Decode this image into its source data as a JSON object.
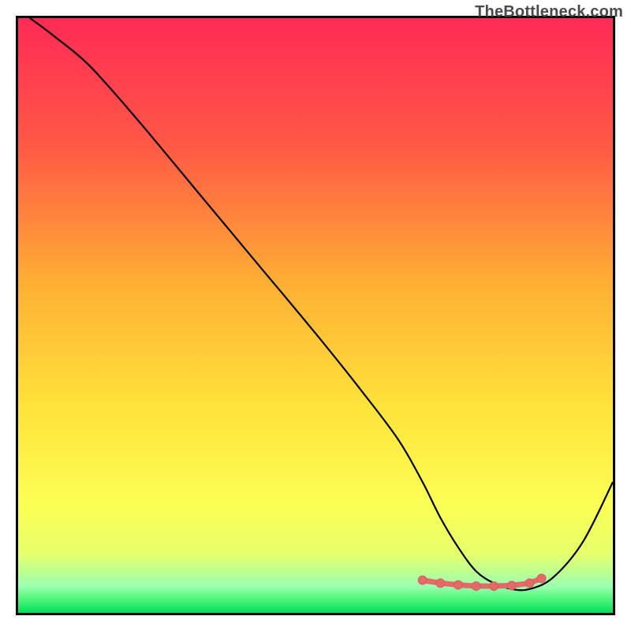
{
  "watermark": "TheBottleneck.com",
  "colors": {
    "frame": "#000000",
    "curve": "#000000",
    "marker_fill": "#e46a6a",
    "marker_stroke": "#d85a5a",
    "gradient_top": "#ff2a55",
    "gradient_mid_upper": "#ff7a3d",
    "gradient_mid": "#ffcf2e",
    "gradient_mid_lower": "#fff04a",
    "gradient_lower": "#f3ff70",
    "gradient_bottom_band": "#7dff8a",
    "gradient_bottom": "#00e05a"
  },
  "chart_data": {
    "type": "line",
    "title": "",
    "xlabel": "",
    "ylabel": "",
    "xlim": [
      0,
      100
    ],
    "ylim": [
      0,
      100
    ],
    "grid": false,
    "legend": false,
    "series": [
      {
        "name": "curve",
        "style": "line",
        "color": "#000000",
        "x": [
          2,
          6,
          12,
          20,
          30,
          40,
          50,
          58,
          64,
          68,
          71,
          74,
          77,
          80,
          83,
          86,
          90,
          95,
          100
        ],
        "y": [
          100,
          97,
          92,
          83,
          71,
          59,
          47,
          37,
          29,
          22,
          16,
          11,
          7,
          5,
          4,
          4,
          6,
          12,
          22
        ]
      },
      {
        "name": "bottleneck-sweet-spot",
        "style": "markers",
        "color": "#e46a6a",
        "x": [
          68,
          71,
          74,
          77,
          80,
          83,
          86,
          88
        ],
        "y": [
          5.5,
          5.0,
          4.7,
          4.5,
          4.5,
          4.6,
          5.0,
          5.8
        ]
      }
    ],
    "background_gradient": {
      "direction": "vertical",
      "stops": [
        {
          "pos": 0.0,
          "color": "#ff2a55"
        },
        {
          "pos": 0.22,
          "color": "#ff5a45"
        },
        {
          "pos": 0.45,
          "color": "#ffb034"
        },
        {
          "pos": 0.65,
          "color": "#ffe23a"
        },
        {
          "pos": 0.82,
          "color": "#fbff55"
        },
        {
          "pos": 0.9,
          "color": "#e7ff6a"
        },
        {
          "pos": 0.955,
          "color": "#9dffb0"
        },
        {
          "pos": 0.975,
          "color": "#55f77e"
        },
        {
          "pos": 1.0,
          "color": "#00e05a"
        }
      ]
    }
  }
}
